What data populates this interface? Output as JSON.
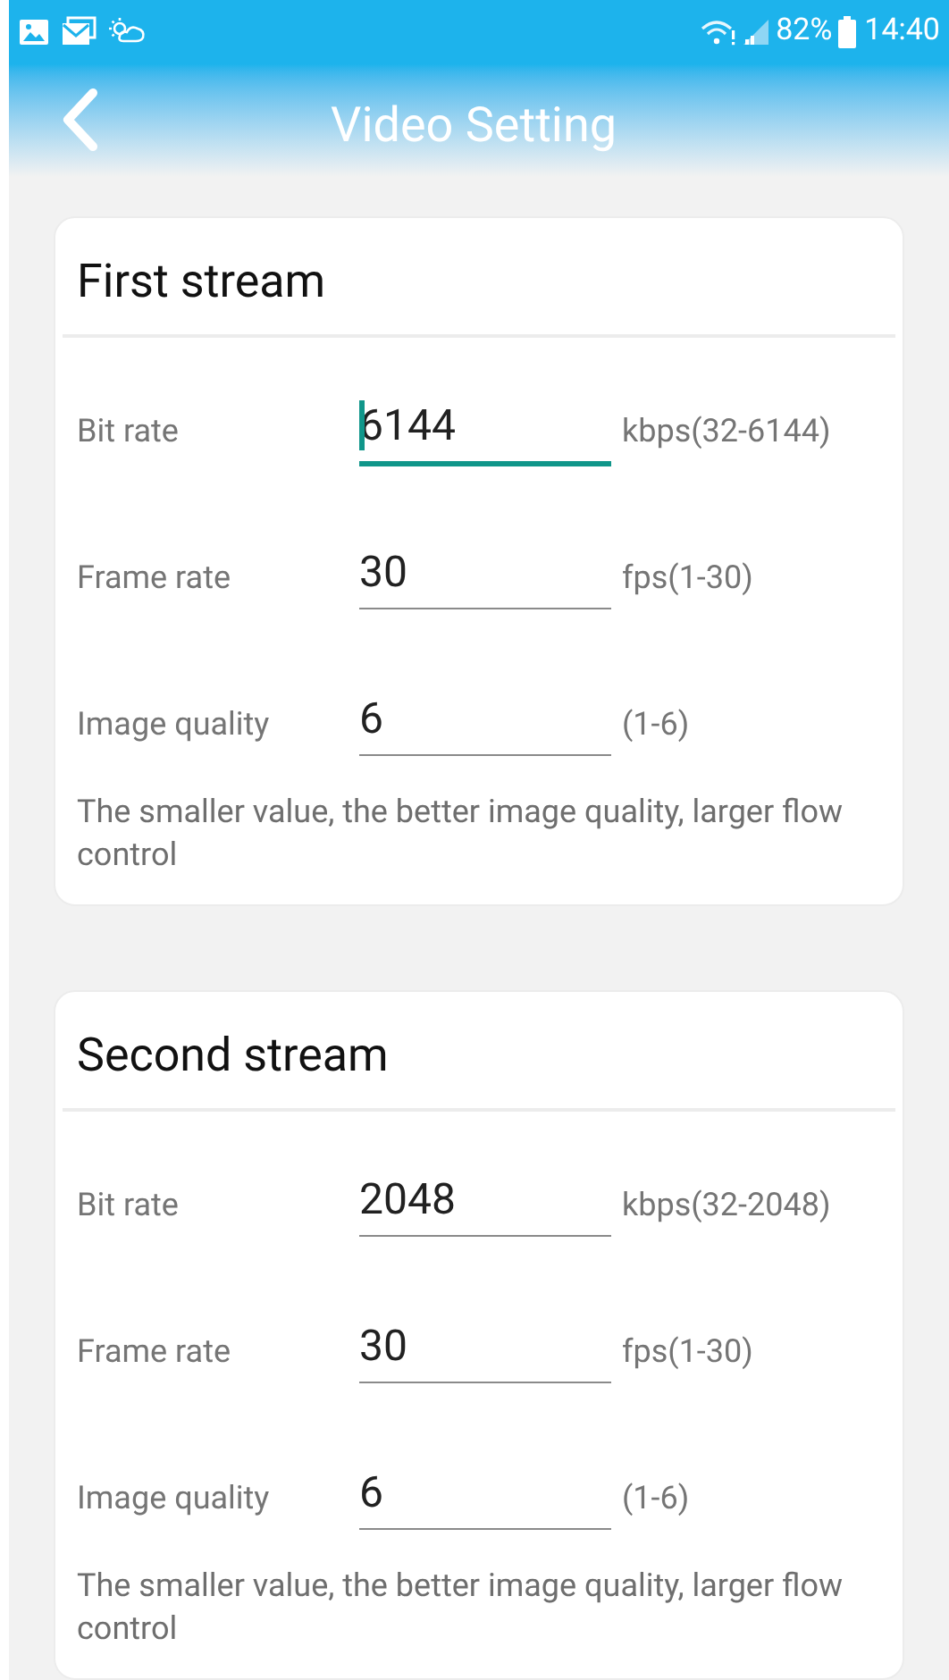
{
  "status_bar": {
    "battery": "82%",
    "time": "14:40"
  },
  "header": {
    "title": "Video Setting"
  },
  "streams": [
    {
      "title": "First stream",
      "fields": [
        {
          "label": "Bit rate",
          "value": "6144",
          "unit": "kbps(32-6144)",
          "focused": true
        },
        {
          "label": "Frame rate",
          "value": "30",
          "unit": "fps(1-30)",
          "focused": false
        },
        {
          "label": "Image quality",
          "value": "6",
          "unit": "(1-6)",
          "focused": false
        }
      ],
      "note": "The smaller value, the better image quality, larger flow control"
    },
    {
      "title": "Second stream",
      "fields": [
        {
          "label": "Bit rate",
          "value": "2048",
          "unit": "kbps(32-2048)",
          "focused": false
        },
        {
          "label": "Frame rate",
          "value": "30",
          "unit": "fps(1-30)",
          "focused": false
        },
        {
          "label": "Image quality",
          "value": "6",
          "unit": "(1-6)",
          "focused": false
        }
      ],
      "note": "The smaller value, the better image quality, larger flow control"
    }
  ]
}
